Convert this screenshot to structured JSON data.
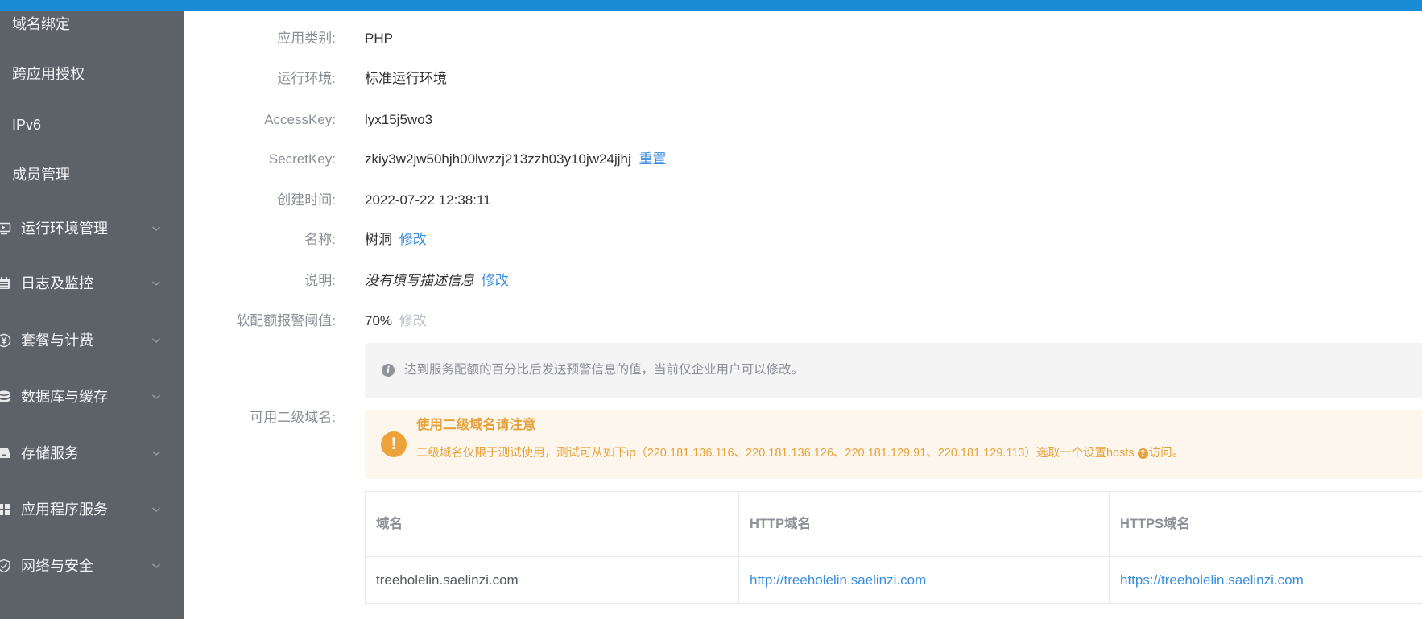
{
  "colors": {
    "topbar": "#1a8cd6",
    "sidebar_bg": "#5d6269",
    "link": "#3a8ee0",
    "warning": "#e6a23c",
    "info_bg": "#f4f4f5"
  },
  "sidebar": {
    "items": [
      {
        "label": "域名绑定"
      },
      {
        "label": "跨应用授权"
      },
      {
        "label": "IPv6"
      },
      {
        "label": "成员管理"
      },
      {
        "label": "运行环境管理",
        "icon": "monitor-icon"
      },
      {
        "label": "日志及监控",
        "icon": "calendar-icon"
      },
      {
        "label": "套餐与计费",
        "icon": "yen-icon"
      },
      {
        "label": "数据库与缓存",
        "icon": "database-icon"
      },
      {
        "label": "存储服务",
        "icon": "storage-icon"
      },
      {
        "label": "应用程序服务",
        "icon": "grid-icon"
      },
      {
        "label": "网络与安全",
        "icon": "shield-icon"
      }
    ]
  },
  "details": {
    "app_type": {
      "label": "应用类别:",
      "value": "PHP"
    },
    "runtime": {
      "label": "运行环境:",
      "value": "标准运行环境"
    },
    "access_key": {
      "label": "AccessKey:",
      "value": "lyx15j5wo3"
    },
    "secret_key": {
      "label": "SecretKey:",
      "value": "zkiy3w2jw50hjh00lwzzj213zzh03y10jw24jjhj",
      "action": "重置"
    },
    "created": {
      "label": "创建时间:",
      "value": "2022-07-22 12:38:11"
    },
    "name": {
      "label": "名称:",
      "value": "树洞",
      "action": "修改"
    },
    "description": {
      "label": "说明:",
      "value": "没有填写描述信息",
      "action": "修改"
    },
    "quota_alert": {
      "label": "软配额报警阈值:",
      "value": "70%",
      "action": "修改"
    }
  },
  "quota_info": {
    "icon": "info-icon",
    "text": "达到服务配额的百分比后发送预警信息的值，当前仅企业用户可以修改。"
  },
  "subdomain": {
    "label": "可用二级域名:",
    "warning": {
      "icon": "exclamation-icon",
      "title": "使用二级域名请注意",
      "text_before": "二级域名仅限于测试使用，测试可从如下ip（220.181.136.116、220.181.136.126、220.181.129.91、220.181.129.113）选取一个设置hosts",
      "help_icon": "?",
      "text_after": "访问。"
    },
    "table": {
      "headers": [
        "域名",
        "HTTP域名",
        "HTTPS域名"
      ],
      "rows": [
        [
          "treeholelin.saelinzi.com",
          "http://treeholelin.saelinzi.com",
          "https://treeholelin.saelinzi.com"
        ]
      ]
    }
  }
}
